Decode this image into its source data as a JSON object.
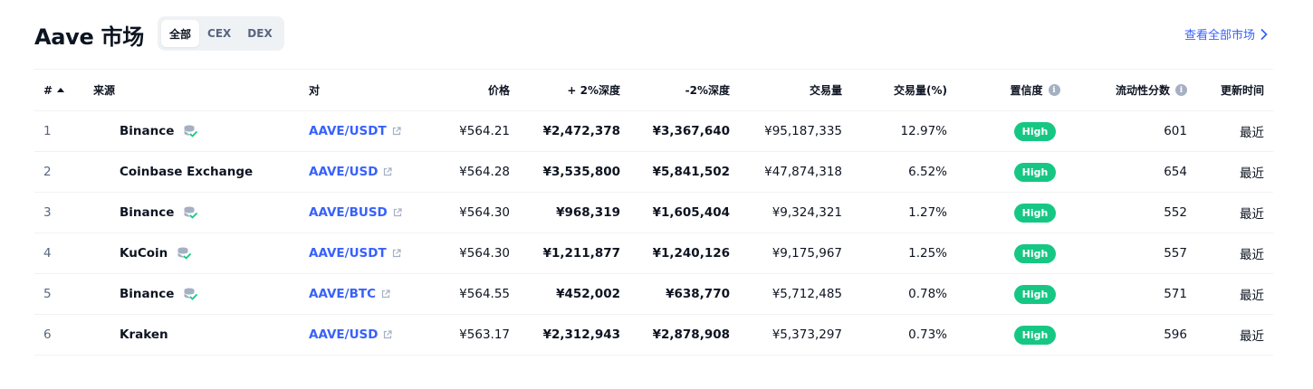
{
  "header": {
    "title": "Aave 市场",
    "filters": [
      {
        "label": "全部",
        "active": true
      },
      {
        "label": "CEX",
        "active": false
      },
      {
        "label": "DEX",
        "active": false
      }
    ],
    "view_all": "查看全部市场"
  },
  "columns": {
    "rank": "#",
    "source": "来源",
    "pair": "对",
    "price": "价格",
    "plus2": "+ 2%深度",
    "minus2": "-2%深度",
    "volume": "交易量",
    "volume_pct": "交易量(%)",
    "confidence": "置信度",
    "liquidity": "流动性分数",
    "updated": "更新时间"
  },
  "colors": {
    "link": "#3861fb",
    "badge_green": "#16c784",
    "muted": "#58667e"
  },
  "rows": [
    {
      "rank": "1",
      "exchange": "Binance",
      "verified": true,
      "pair": "AAVE/USDT",
      "price": "¥564.21",
      "plus2": "¥2,472,378",
      "minus2": "¥3,367,640",
      "volume": "¥95,187,335",
      "volume_pct": "12.97%",
      "confidence": "High",
      "liquidity": "601",
      "updated": "最近"
    },
    {
      "rank": "2",
      "exchange": "Coinbase Exchange",
      "verified": false,
      "pair": "AAVE/USD",
      "price": "¥564.28",
      "plus2": "¥3,535,800",
      "minus2": "¥5,841,502",
      "volume": "¥47,874,318",
      "volume_pct": "6.52%",
      "confidence": "High",
      "liquidity": "654",
      "updated": "最近"
    },
    {
      "rank": "3",
      "exchange": "Binance",
      "verified": true,
      "pair": "AAVE/BUSD",
      "price": "¥564.30",
      "plus2": "¥968,319",
      "minus2": "¥1,605,404",
      "volume": "¥9,324,321",
      "volume_pct": "1.27%",
      "confidence": "High",
      "liquidity": "552",
      "updated": "最近"
    },
    {
      "rank": "4",
      "exchange": "KuCoin",
      "verified": true,
      "pair": "AAVE/USDT",
      "price": "¥564.30",
      "plus2": "¥1,211,877",
      "minus2": "¥1,240,126",
      "volume": "¥9,175,967",
      "volume_pct": "1.25%",
      "confidence": "High",
      "liquidity": "557",
      "updated": "最近"
    },
    {
      "rank": "5",
      "exchange": "Binance",
      "verified": true,
      "pair": "AAVE/BTC",
      "price": "¥564.55",
      "plus2": "¥452,002",
      "minus2": "¥638,770",
      "volume": "¥5,712,485",
      "volume_pct": "0.78%",
      "confidence": "High",
      "liquidity": "571",
      "updated": "最近"
    },
    {
      "rank": "6",
      "exchange": "Kraken",
      "verified": false,
      "pair": "AAVE/USD",
      "price": "¥563.17",
      "plus2": "¥2,312,943",
      "minus2": "¥2,878,908",
      "volume": "¥5,373,297",
      "volume_pct": "0.73%",
      "confidence": "High",
      "liquidity": "596",
      "updated": "最近"
    }
  ]
}
